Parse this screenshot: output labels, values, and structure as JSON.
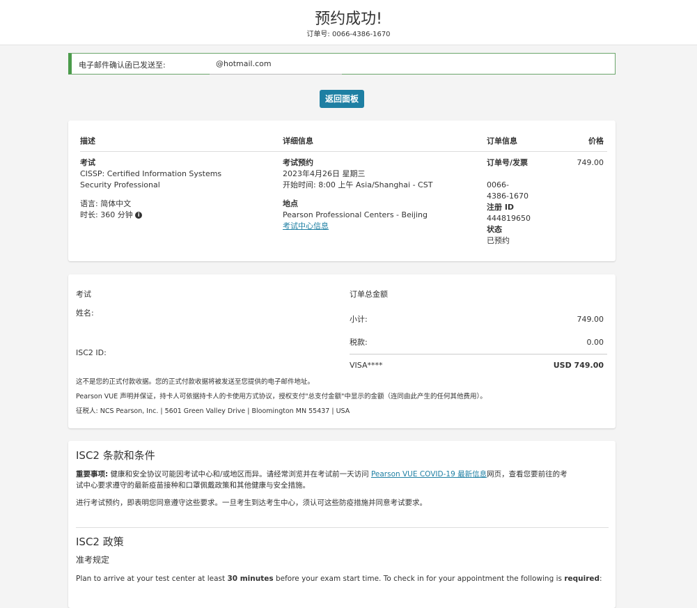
{
  "header": {
    "title": "预约成功!",
    "order_label": "订单号:",
    "order_number": "0066-4386-1670"
  },
  "email": {
    "label": "电子邮件确认函已发送至:",
    "address": "@hotmail.com"
  },
  "back_button": "返回面板",
  "order_table": {
    "headers": {
      "description": "描述",
      "details": "详细信息",
      "order_info": "订单信息",
      "price": "价格"
    },
    "exam_label": "考试",
    "exam_name": "CISSP: Certified Information Systems Security Professional",
    "language": "语言: 简体中文",
    "duration": "时长: 360 分钟",
    "appointment_label": "考试预约",
    "appointment_date": "2023年4月26日 星期三",
    "appointment_time": "开始时间:  8:00 上午 Asia/Shanghai - CST",
    "location_label": "地点",
    "location_name": "Pearson Professional Centers - Beijing",
    "center_info_link": "考试中心信息",
    "order_invoice_label": "订单号/发票",
    "order_invoice_value": "0066-4386-1670",
    "registration_label": "注册 ID",
    "registration_value": "444819650",
    "status_label": "状态",
    "status_value": "已预约",
    "price": "749.00"
  },
  "receipt": {
    "exam_label": "考试",
    "name_label": "姓名:",
    "id_label": "ISC2 ID:",
    "total_label": "订单总金额",
    "subtotal_label": "小计:",
    "subtotal_value": "749.00",
    "tax_label": "税款:",
    "tax_value": "0.00",
    "card_label": "VISA****",
    "total_value": "USD 749.00",
    "note1": "这不是您的正式付款收据。您的正式付款收据将被发送至您提供的电子邮件地址。",
    "note2": "Pearson VUE 声明并保证，持卡人可依据持卡人的卡使用方式协议，授权支付\"总支付金额\"中显示的金额（连同由此产生的任何其他费用）。",
    "note3": "征税人: NCS Pearson, Inc. | 5601 Green Valley Drive | Bloomington MN 55437 | USA"
  },
  "terms": {
    "title": "ISC2 条款和条件",
    "important_label": "重要事项:",
    "important_text_1": "健康和安全协议可能因考试中心和/或地区而异。请经常浏览并在考试前一天访问",
    "covid_link": "Pearson VUE COVID-19 最新信息",
    "important_text_2": "网页，查看您要前往的考",
    "important_text_3": "试中心要求遵守的最新疫苗接种和口罩佩戴政策和其他健康与安全措施。",
    "agree_text": "进行考试预约，即表明您同意遵守这些要求。一旦考生到达考生中心，须认可这些防疫措施并同意考试要求。"
  },
  "policy": {
    "title": "ISC2 政策",
    "subtitle": "准考规定",
    "arrive_prefix": "Plan to arrive at your test center at least ",
    "arrive_bold": "30 minutes",
    "arrive_mid": " before your exam start time. To check in for your appointment the following is ",
    "arrive_required": "required",
    "arrive_suffix": ":"
  }
}
